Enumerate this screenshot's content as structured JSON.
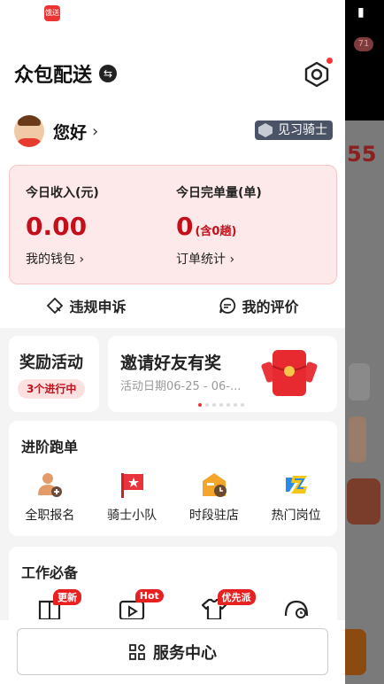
{
  "app": {
    "title": "众包配送",
    "icon_text": "饿送"
  },
  "background": {
    "badge": "71",
    "partial_number": "55"
  },
  "user": {
    "greeting": "您好",
    "level": "见习骑士"
  },
  "income": {
    "today_income_label": "今日收入(元)",
    "today_income_value": "0.00",
    "wallet_link": "我的钱包",
    "today_orders_label": "今日完单量(单)",
    "today_orders_value": "0",
    "today_orders_sub": "(含0趟)",
    "orders_link": "订单统计"
  },
  "actions": [
    {
      "label": "违规申诉",
      "icon": "appeal-icon"
    },
    {
      "label": "我的评价",
      "icon": "comment-icon"
    }
  ],
  "reward": {
    "title": "奖励活动",
    "pill": "3个进行中"
  },
  "invite": {
    "title": "邀请好友有奖",
    "date": "活动日期06-25 - 06-..."
  },
  "advance": {
    "title": "进阶跑单",
    "items": [
      {
        "label": "全职报名",
        "icon": "fulltime-signup-icon"
      },
      {
        "label": "骑士小队",
        "icon": "rider-team-icon"
      },
      {
        "label": "时段驻店",
        "icon": "shift-store-icon"
      },
      {
        "label": "热门岗位",
        "icon": "hot-position-icon"
      }
    ]
  },
  "work": {
    "title": "工作必备",
    "items": [
      {
        "tag": "更新",
        "icon": "guide-book-icon"
      },
      {
        "tag": "Hot",
        "icon": "video-icon"
      },
      {
        "tag": "优先派",
        "icon": "uniform-icon"
      },
      {
        "tag": "",
        "icon": "helmet-icon"
      }
    ]
  },
  "bottom": {
    "service_label": "服务中心"
  },
  "colors": {
    "accent": "#c40f1a",
    "badge_bg": "#4b5366",
    "card_bg": "#fde9e9"
  }
}
